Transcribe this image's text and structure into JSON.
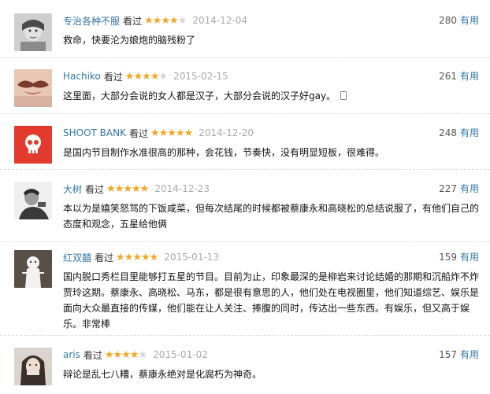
{
  "watched_label": "看过",
  "useful_label": "有用",
  "comments": [
    {
      "user": "专治各种不服",
      "rating": 4,
      "date": "2014-12-04",
      "votes": "280",
      "text": "救命，快要沦为娘炮的脑残粉了",
      "avatar": "child-portrait"
    },
    {
      "user": "Hachiko",
      "rating": 4,
      "date": "2015-02-15",
      "votes": "261",
      "text": "这里面，大部分会说的女人都是汉子，大部分会说的汉子好gay。",
      "avatar": "mustache-lips",
      "mobile_icon": "mobile-phone-icon"
    },
    {
      "user": "SHOOT BANK",
      "rating": 5,
      "date": "2014-12-20",
      "votes": "248",
      "text": "是国内节目制作水准很高的那种，会花钱，节奏快，没有明显短板，很难得。",
      "avatar": "skull-red"
    },
    {
      "user": "大树",
      "rating": 5,
      "date": "2014-12-23",
      "votes": "227",
      "text": "本以为是嬉笑怒骂的下饭咸菜，但每次结尾的时候都被蔡康永和高晓松的总结说服了，有他们自己的态度和观念，五星给他俩",
      "avatar": "bw-portrait"
    },
    {
      "user": "红双囍",
      "rating": 5,
      "date": "2015-01-13",
      "votes": "159",
      "text": "国内脱口秀栏目里能够打五星的节目。目前为止，印象最深的是柳岩来讨论结婚的那期和沉船炸不炸贾玲这期。蔡康永、高晓松、马东，都是很有意思的人，他们处在电视圈里，他们知道综艺、娱乐是面向大众最直接的传媒，他们能在让人关注、捧腹的同时，传达出一些东西。有娱乐，但又高于娱乐。非常棒",
      "avatar": "white-figure"
    },
    {
      "user": "aris",
      "rating": 4,
      "date": "2015-01-02",
      "votes": "157",
      "text": "辩论是乱七八糟，蔡康永绝对是化腐朽为神奇。",
      "avatar": "girl-portrait"
    }
  ]
}
